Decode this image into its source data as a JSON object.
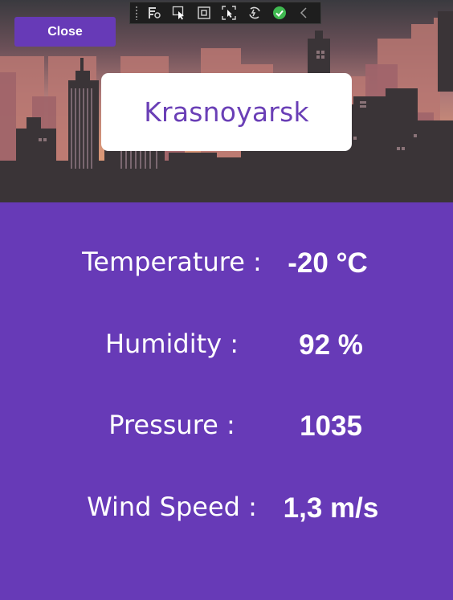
{
  "toolbar": {
    "items": [
      {
        "icon": "live-visual-tree-icon"
      },
      {
        "icon": "select-element-icon"
      },
      {
        "icon": "display-layout-adorners-icon"
      },
      {
        "icon": "track-focused-element-icon"
      },
      {
        "icon": "hot-reload-icon"
      },
      {
        "icon": "binding-failures-ok-icon",
        "color": "#3fb950"
      },
      {
        "icon": "collapse-toolbar-icon"
      }
    ]
  },
  "close_button": {
    "label": "Close"
  },
  "city": {
    "name": "Krasnoyarsk"
  },
  "stats": [
    {
      "label": "Temperature :",
      "value": "-20 °C"
    },
    {
      "label": "Humidity :",
      "value": "92 %"
    },
    {
      "label": "Pressure :",
      "value": "1035"
    },
    {
      "label": "Wind Speed :",
      "value": "1,3 m/s"
    }
  ],
  "colors": {
    "background": "#673ab7",
    "accent": "#673ab7",
    "card": "#ffffff",
    "city_text": "#6a3fb6",
    "text": "#ffffff"
  }
}
